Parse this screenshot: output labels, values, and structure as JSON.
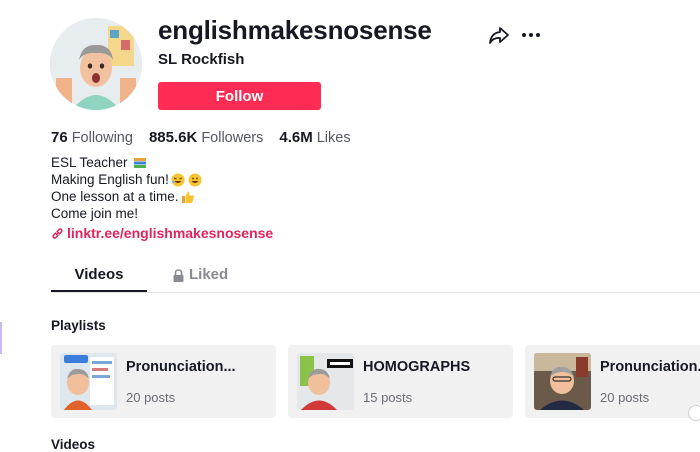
{
  "profile": {
    "username": "englishmakesnosense",
    "nickname": "SL Rockfish",
    "follow_label": "Follow",
    "accent_color": "#fe2c55"
  },
  "stats": {
    "following_count": "76",
    "following_label": "Following",
    "followers_count": "885.6K",
    "followers_label": "Followers",
    "likes_count": "4.6M",
    "likes_label": "Likes"
  },
  "bio": {
    "line1": "ESL Teacher",
    "line2": "Making English fun!",
    "line3": "One lesson at a time.",
    "line4": "Come join me!",
    "link": "linktr.ee/englishmakesnosense",
    "emojis": [
      "books-emoji",
      "laughing-emoji",
      "grinning-emoji",
      "thumbs-up-emoji"
    ]
  },
  "tabs": [
    {
      "label": "Videos",
      "active": true
    },
    {
      "label": "Liked",
      "active": false,
      "icon": "lock-icon"
    }
  ],
  "playlists": {
    "heading": "Playlists",
    "items": [
      {
        "title": "Pronunciation...",
        "posts": "20 posts"
      },
      {
        "title": "HOMOGRAPHS",
        "posts": "15 posts"
      },
      {
        "title": "Pronunciation...",
        "posts": "20 posts"
      }
    ]
  },
  "videos_heading": "Videos",
  "icons": [
    "share-icon",
    "more-options-icon",
    "link-icon",
    "lock-icon"
  ]
}
